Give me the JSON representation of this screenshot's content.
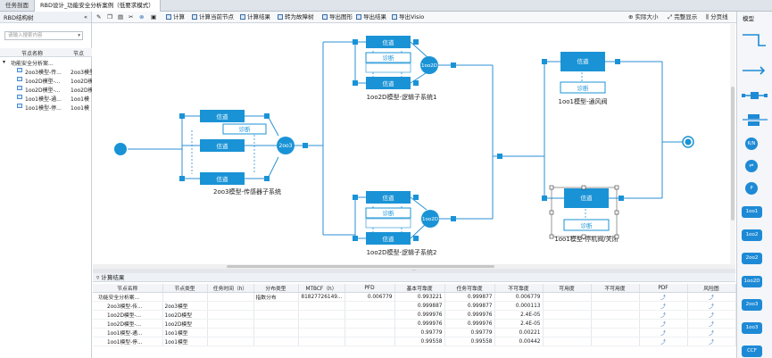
{
  "tabs": [
    "任务剖面",
    "RBD设计_功能安全分析案例（低要求模式）"
  ],
  "left_panel": {
    "title": "RBD结构树",
    "collapse_icon": "«",
    "search_placeholder": "请输入搜索内容",
    "columns": [
      "节点名称",
      "节点"
    ],
    "tree": [
      {
        "name": "功能安全分析案...",
        "type": "",
        "root": true
      },
      {
        "name": "2oo3模型-传...",
        "type": "2oo3模型"
      },
      {
        "name": "1oo2D模型-...",
        "type": "1oo2D模型"
      },
      {
        "name": "1oo2D模型-...",
        "type": "1oo2D模"
      },
      {
        "name": "1oo1模型-通...",
        "type": "1oo1模"
      },
      {
        "name": "1oo1模型-停...",
        "type": "1oo1模"
      }
    ]
  },
  "toolbar": {
    "calc": "计算",
    "calc_node": "计算当前节点",
    "calc_result": "计算结果",
    "to_fault_tree": "转为故障树",
    "export_graph": "导出图形",
    "export_result": "导出结果",
    "export_visio": "导出Visio",
    "actual_size": "实际大小",
    "full_display": "完整显示",
    "paging": "分页线"
  },
  "diagram": {
    "channel": "信道",
    "diag": "诊断",
    "vote_2oo3": "2oo3",
    "vote_1oo2d": "1oo2D",
    "caption_2oo3": "2oo3模型-传感器子系统",
    "caption_1oo2d_1": "1oo2D模型-逻辑子系统1",
    "caption_1oo2d_2": "1oo2D模型-逻辑子系统2",
    "caption_1oo1_1": "1oo1模型-通风阀",
    "caption_1oo1_2": "1oo1模型-停机阀/关闭"
  },
  "results": {
    "title": "计算结果",
    "columns": [
      "节点名称",
      "节点类型",
      "任务时间（h）",
      "分布类型",
      "MTBCF（h）",
      "PFD",
      "基本可靠度",
      "任务可靠度",
      "不可靠度",
      "可用度",
      "不可用度",
      "PDF",
      "风险图"
    ],
    "rows": [
      {
        "name": "功能安全分析案...",
        "type": "",
        "time": "",
        "dist": "指数分布",
        "mtbcf": "81827726149...",
        "pfd": "0.006779",
        "basic": "0.993221",
        "mission": "0.999877",
        "unrel": "0.006779"
      },
      {
        "name": "2oo3模型-传...",
        "type": "2oo3模型",
        "time": "",
        "dist": "",
        "mtbcf": "",
        "pfd": "",
        "basic": "0.999887",
        "mission": "0.999877",
        "unrel": "0.000113"
      },
      {
        "name": "1oo2D模型-...",
        "type": "1oo2D模型",
        "time": "",
        "dist": "",
        "mtbcf": "",
        "pfd": "",
        "basic": "0.999976",
        "mission": "0.999976",
        "unrel": "2.4E-05"
      },
      {
        "name": "1oo2D模型-...",
        "type": "1oo2D模型",
        "time": "",
        "dist": "",
        "mtbcf": "",
        "pfd": "",
        "basic": "0.999976",
        "mission": "0.999976",
        "unrel": "2.4E-05"
      },
      {
        "name": "1oo1模型-通...",
        "type": "1oo1模型",
        "time": "",
        "dist": "",
        "mtbcf": "",
        "pfd": "",
        "basic": "0.99779",
        "mission": "0.99779",
        "unrel": "0.00221"
      },
      {
        "name": "1oo1模型-停...",
        "type": "1oo1模型",
        "time": "",
        "dist": "",
        "mtbcf": "",
        "pfd": "",
        "basic": "0.99558",
        "mission": "0.99558",
        "unrel": "0.00442"
      }
    ]
  },
  "palette": {
    "title": "模型",
    "items": [
      "K/N",
      "P",
      "1oo1",
      "1oo2",
      "2oo2",
      "1oo2D",
      "2oo3",
      "1oo3",
      "CCF"
    ]
  },
  "colors": {
    "accent": "#1e8ad6",
    "block": "#1a93d6",
    "line": "#2b8fd4"
  }
}
